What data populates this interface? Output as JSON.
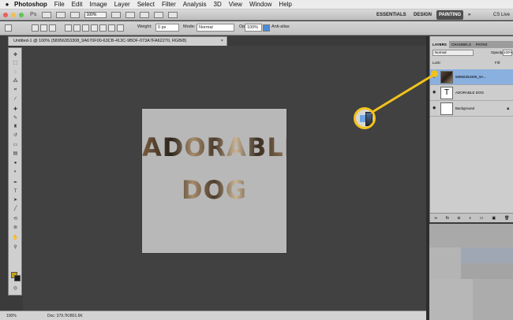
{
  "menubar": {
    "app_name": "Photoshop",
    "items": [
      "File",
      "Edit",
      "Image",
      "Layer",
      "Select",
      "Filter",
      "Analysis",
      "3D",
      "View",
      "Window",
      "Help"
    ]
  },
  "appbar": {
    "ps_logo": "Ps",
    "zoom_value": "100%",
    "workspaces": [
      "ESSENTIALS",
      "DESIGN",
      "PAINTING"
    ],
    "active_workspace": "PAINTING",
    "more": "»",
    "cs_live": "CS Live"
  },
  "options": {
    "weight_label": "Weight:",
    "weight_value": "0 px",
    "mode_label": "Mode:",
    "mode_value": "Normal",
    "opacity_label": "Opacity:",
    "opacity_value": "100%",
    "antialias_label": "Anti-alias"
  },
  "document": {
    "tab_title": "Untitled-1 @ 100% (58956353308_9A670F00-63CB-413C-9BDF-073A7FA62270, RGB/8)",
    "close": "×",
    "line1": "ADORABLE",
    "line2": "DOG"
  },
  "status": {
    "zoom": "100%",
    "doc_info": "Doc: 379.7K/801.6K"
  },
  "layers_panel": {
    "tabs": [
      "LAYERS",
      "CHANNELS",
      "PATHS"
    ],
    "blend_mode": "Normal",
    "opacity_label": "Opacity:",
    "opacity_value": "100%",
    "lock_label": "Lock:",
    "fill_label": "Fill:",
    "fill_value": "100%",
    "layers": [
      {
        "name": "58956353308_9A...",
        "selected": true
      },
      {
        "name": "ADORABLE DOG",
        "selected": false
      },
      {
        "name": "Background",
        "selected": false
      }
    ],
    "bottom_icons": [
      "link-icon",
      "fx-icon",
      "mask-icon",
      "adjustment-icon",
      "folder-icon",
      "new-layer-icon",
      "trash-icon"
    ]
  },
  "colors": {
    "foreground": "#c9a20b",
    "background": "#1a1a1a",
    "callout": "#f2c21b",
    "selection": "#8ab0e0"
  }
}
